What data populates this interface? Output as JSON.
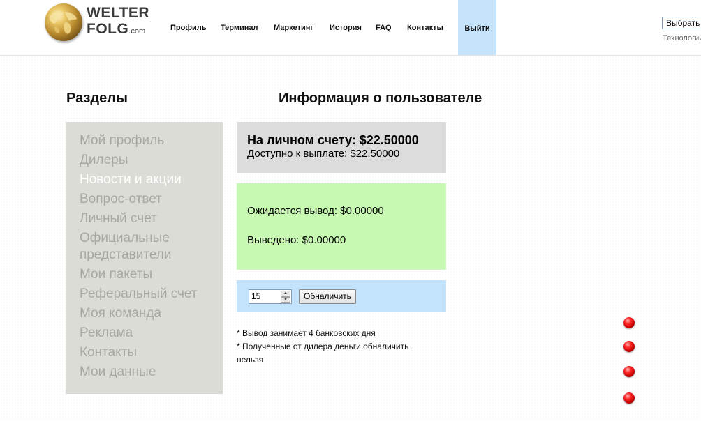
{
  "header": {
    "brand_line1": "WELTER",
    "brand_line2": "FOLG",
    "brand_domain": ".com",
    "nav": {
      "profile": "Профиль",
      "terminal": "Терминал",
      "marketing": "Маркетинг",
      "history": "История",
      "faq": "FAQ",
      "contacts": "Контакты",
      "logout": "Выйти"
    },
    "lang_select_value": "Выбрать",
    "tech_text": "Технологии"
  },
  "sections_title": "Разделы",
  "info_title": "Информация о пользователе",
  "sidebar": {
    "items": [
      {
        "label": "Мой профиль"
      },
      {
        "label": "Дилеры"
      },
      {
        "label": "Новости и акции"
      },
      {
        "label": "Вопрос-ответ"
      },
      {
        "label": "Личный счет"
      },
      {
        "label": "Официальные представители"
      },
      {
        "label": "Мои пакеты"
      },
      {
        "label": "Реферальный счет"
      },
      {
        "label": "Моя команда"
      },
      {
        "label": "Реклама"
      },
      {
        "label": "Контакты"
      },
      {
        "label": "Мои данные"
      }
    ],
    "active_index": 2
  },
  "balance": {
    "account": "На личном счету: $22.50000",
    "available": "Доступно к выплате: $22.50000"
  },
  "withdraw": {
    "pending": "Ожидается вывод: $0.00000",
    "withdrawn": "Выведено: $0.00000"
  },
  "cashout": {
    "amount_value": "15",
    "button_label": "Обналичить"
  },
  "notes": {
    "line1": "* Вывод занимает 4 банковских дня",
    "line2": "* Полученные от дилера деньги обналичить нельзя"
  },
  "colors": {
    "logout_bg": "#c5e4fb",
    "sidebar_bg": "#dcdcd6",
    "balance_bg": "#dcdcdc",
    "withdraw_bg": "#c7f9b2",
    "cashout_bg": "#c3e2fb",
    "dot_red": "#e00000"
  }
}
